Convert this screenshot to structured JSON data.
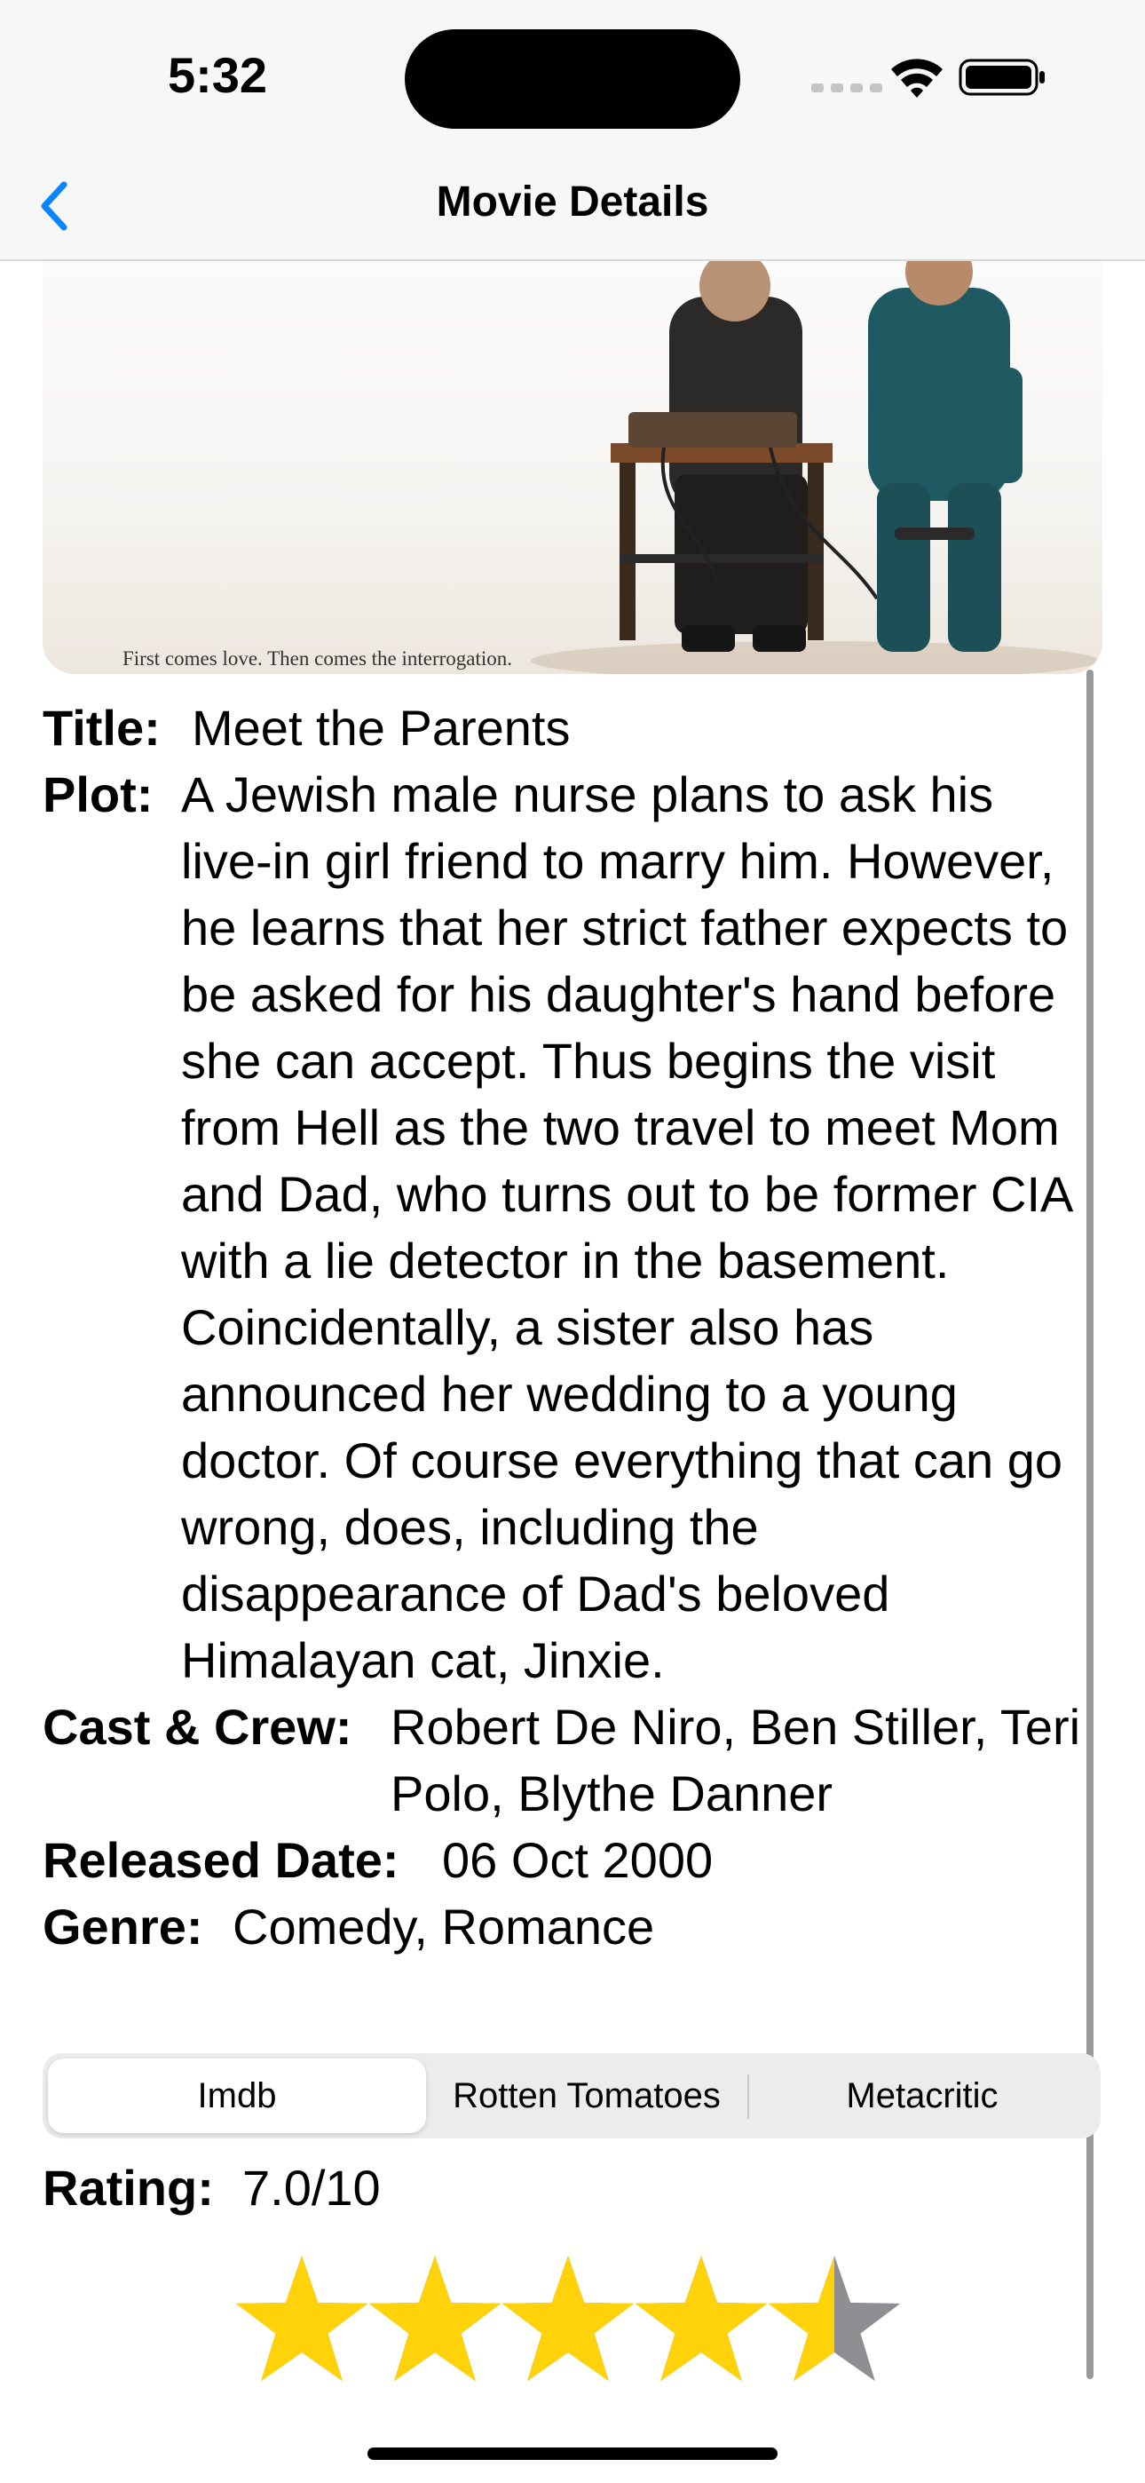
{
  "status_bar": {
    "time": "5:32"
  },
  "nav": {
    "title": "Movie Details"
  },
  "poster": {
    "caption": "First comes love. Then comes the interrogation."
  },
  "details": {
    "title_label": "Title:",
    "title_value": "Meet the Parents",
    "plot_label": "Plot:",
    "plot_value": "A Jewish male nurse plans to ask his live-in girl friend to marry him. However, he learns that her strict father expects to be asked for his daughter's hand before she can accept. Thus begins the visit from Hell as the two travel to meet Mom and Dad, who turns out to be former CIA with a lie detector in the basement. Coincidentally, a sister also has announced her wedding to a young doctor. Of course everything that can go wrong, does, including the disappearance of Dad's beloved Himalayan cat, Jinxie.",
    "cast_label": "Cast & Crew:",
    "cast_value": "Robert De Niro, Ben Stiller, Teri Polo, Blythe Danner",
    "released_label": "Released Date:",
    "released_value": "06 Oct 2000",
    "genre_label": "Genre:",
    "genre_value": "Comedy, Romance"
  },
  "rating_tabs": {
    "items": [
      {
        "label": "Imdb",
        "selected": true
      },
      {
        "label": "Rotten Tomatoes",
        "selected": false
      },
      {
        "label": "Metacritic",
        "selected": false
      }
    ]
  },
  "rating": {
    "label": "Rating:",
    "value": "7.0/10",
    "stars_total": 5,
    "stars_filled": 4.5,
    "star_color": "#FFD20A",
    "star_empty_color": "#8E8E93"
  },
  "colors": {
    "accent": "#0A84FF"
  }
}
